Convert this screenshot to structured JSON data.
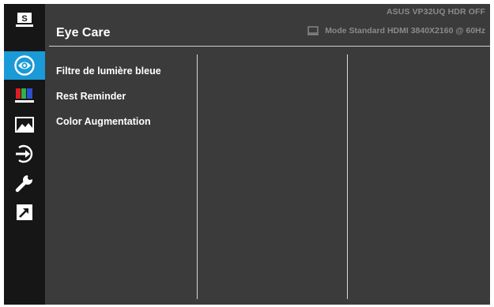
{
  "header": {
    "title": "Eye Care",
    "model_line": "ASUS  VP32UQ  HDR OFF",
    "mode_line": "Mode Standard HDMI 3840X2160 @ 60Hz"
  },
  "sidebar": {
    "items": [
      {
        "name": "splendid",
        "glyph": "S",
        "active": false
      },
      {
        "name": "eye-care",
        "glyph": "",
        "active": true
      },
      {
        "name": "color",
        "glyph": "",
        "active": false
      },
      {
        "name": "image",
        "glyph": "",
        "active": false
      },
      {
        "name": "input-select",
        "glyph": "",
        "active": false
      },
      {
        "name": "system-setup",
        "glyph": "",
        "active": false
      },
      {
        "name": "shortcut",
        "glyph": "",
        "active": false
      }
    ]
  },
  "menu": {
    "items": [
      {
        "label": "Filtre de lumière bleue"
      },
      {
        "label": "Rest Reminder"
      },
      {
        "label": "Color Augmentation"
      }
    ]
  },
  "colors": {
    "accent": "#1a9ad6",
    "sidebar_bg": "#161616",
    "panel_bg": "#3b3b3b"
  }
}
